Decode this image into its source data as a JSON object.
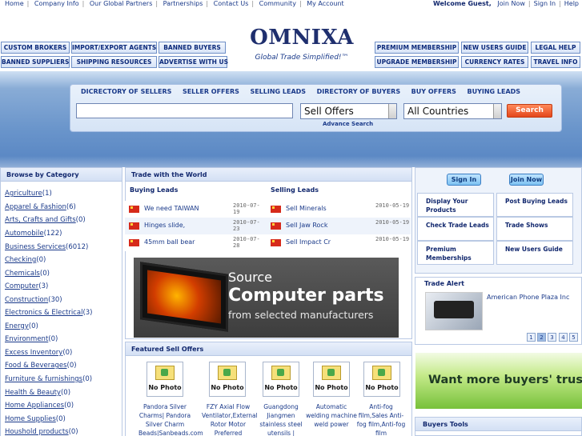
{
  "topbar": {
    "links": [
      "Home",
      "Company Info",
      "Our Global Partners",
      "Partnerships",
      "Contact Us",
      "Community",
      "My Account"
    ],
    "welcome": "Welcome Guest,",
    "right_links": [
      "Join Now",
      "Sign In",
      "Help"
    ]
  },
  "nav_left_row1": [
    "CUSTOM BROKERS",
    "IMPORT/EXPORT AGENTS",
    "BANNED BUYERS"
  ],
  "nav_left_row2": [
    "BANNED SUPPLIERS",
    "SHIPPING RESOURCES",
    "ADVERTISE WITH US"
  ],
  "nav_right_row1": [
    "PREMIUM MEMBERSHIP",
    "NEW USERS GUIDE",
    "LEGAL HELP"
  ],
  "nav_right_row2": [
    "UPGRADE MEMBERSHIP",
    "CURRENCY RATES",
    "TRAVEL INFO"
  ],
  "logo": {
    "text": "OMNIXA",
    "slogan": "Global Trade Simplified!™"
  },
  "search": {
    "tabs": [
      "DICRECTORY OF SELLERS",
      "SELLER OFFERS",
      "SELLING LEADS",
      "DIRECTORY OF BUYERS",
      "BUY OFFERS",
      "BUYING LEADS"
    ],
    "query": "",
    "type_select": "Sell Offers",
    "country_select": "All Countries",
    "button": "Search",
    "advanced": "Advance Search"
  },
  "categories": {
    "title": "Browse by Category",
    "items": [
      {
        "name": "Agriculture",
        "count": "(1)"
      },
      {
        "name": "Apparel & Fashion",
        "count": "(6)"
      },
      {
        "name": "Arts, Crafts and Gifts",
        "count": "(0)"
      },
      {
        "name": "Automobile",
        "count": "(122)"
      },
      {
        "name": "Business Services",
        "count": "(6012)"
      },
      {
        "name": "Checking",
        "count": "(0)"
      },
      {
        "name": "Chemicals",
        "count": "(0)"
      },
      {
        "name": "Computer",
        "count": "(3)"
      },
      {
        "name": "Construction",
        "count": "(30)"
      },
      {
        "name": "Electronics & Electrical",
        "count": "(3)"
      },
      {
        "name": "Energy",
        "count": "(0)"
      },
      {
        "name": "Environment",
        "count": "(0)"
      },
      {
        "name": "Excess Inventory",
        "count": "(0)"
      },
      {
        "name": "Food & Beverages",
        "count": "(0)"
      },
      {
        "name": "Furniture & furnishings",
        "count": "(0)"
      },
      {
        "name": "Health & Beauty",
        "count": "(0)"
      },
      {
        "name": "Home Appliances",
        "count": "(0)"
      },
      {
        "name": "Home Supplies",
        "count": "(0)"
      },
      {
        "name": "Houshold products",
        "count": "(0)"
      }
    ]
  },
  "trade": {
    "title": "Trade with the World",
    "buying_title": "Buying Leads",
    "selling_title": "Selling Leads",
    "buying": [
      {
        "text": "We need TAIWAN",
        "date": "2010-07-19"
      },
      {
        "text": "Hinges slide,",
        "date": "2010-07-23"
      },
      {
        "text": "45mm ball bear",
        "date": "2010-07-28"
      }
    ],
    "selling": [
      {
        "text": "Sell Minerals",
        "date": "2010-05-19"
      },
      {
        "text": "Sell Jaw Rock",
        "date": "2010-05-19"
      },
      {
        "text": "Sell Impact Cr",
        "date": "2010-05-19"
      }
    ]
  },
  "banner": {
    "line1": "Source",
    "line2": "Computer parts",
    "line3": "from selected manufacturers"
  },
  "featured": {
    "title": "Featured Sell Offers",
    "no_photo": "No Photo",
    "items": [
      "Pandora Silver Charms| Pandora Silver Charm Beads|Sanbeads.com",
      "FZY Axial Flow Ventilator,External Rotor Motor Preferred",
      "Guangdong Jiangmen stainless steel utensils |",
      "Automatic welding machine weld power",
      "Anti-fog film,Sales Anti-fog film,Anti-fog film"
    ]
  },
  "account": {
    "sign_in": "Sign In",
    "join_now": "Join Now",
    "links": [
      "Display Your Products",
      "Post Buying Leads",
      "Check Trade Leads",
      "Trade Shows",
      "Premium Memberships",
      "New Users Guide"
    ]
  },
  "trade_alert": {
    "title": "Trade Alert",
    "item": "American Phone Plaza Inc",
    "pages": [
      "1",
      "2",
      "3",
      "4",
      "5"
    ],
    "current_page": "2"
  },
  "trust_banner": "Want more buyers' trust?",
  "buyers_tools": "Buyers Tools"
}
